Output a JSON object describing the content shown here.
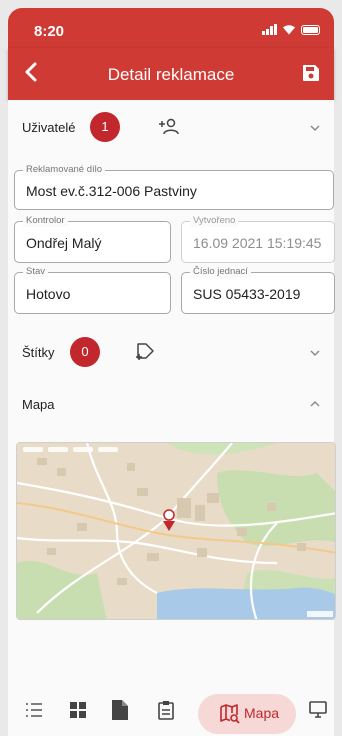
{
  "status_bar": {
    "time": "8:20"
  },
  "header": {
    "title": "Detail reklamace",
    "back_icon": "chevron-left-icon",
    "save_icon": "floppy-disk-icon"
  },
  "users_section": {
    "label": "Uživatelé",
    "count": "1",
    "add_icon": "person-add-icon"
  },
  "fields": {
    "reklamovane_dilo": {
      "label": "Reklamované dílo",
      "value": "Most ev.č.312-006 Pastviny"
    },
    "kontrolor": {
      "label": "Kontrolor",
      "value": "Ondřej Malý"
    },
    "vytvoreno": {
      "label": "Vytvořeno",
      "value": "16.09 2021 15:19:45"
    },
    "stav": {
      "label": "Stav",
      "value": "Hotovo"
    },
    "cislo_jednaci": {
      "label": "Číslo jednací",
      "value": "SUS 05433-2019"
    }
  },
  "tags_section": {
    "label": "Štítky",
    "count": "0",
    "add_icon": "tag-add-icon"
  },
  "map_section": {
    "label": "Mapa"
  },
  "bottom_nav": {
    "items": [
      "list-icon",
      "grid-icon",
      "document-icon",
      "clipboard-icon",
      "map-icon",
      "desktop-icon"
    ],
    "active_label": "Mapa"
  },
  "colors": {
    "primary": "#cf3a34",
    "badge": "#c1272d",
    "active_pill": "#f6d8d6"
  }
}
